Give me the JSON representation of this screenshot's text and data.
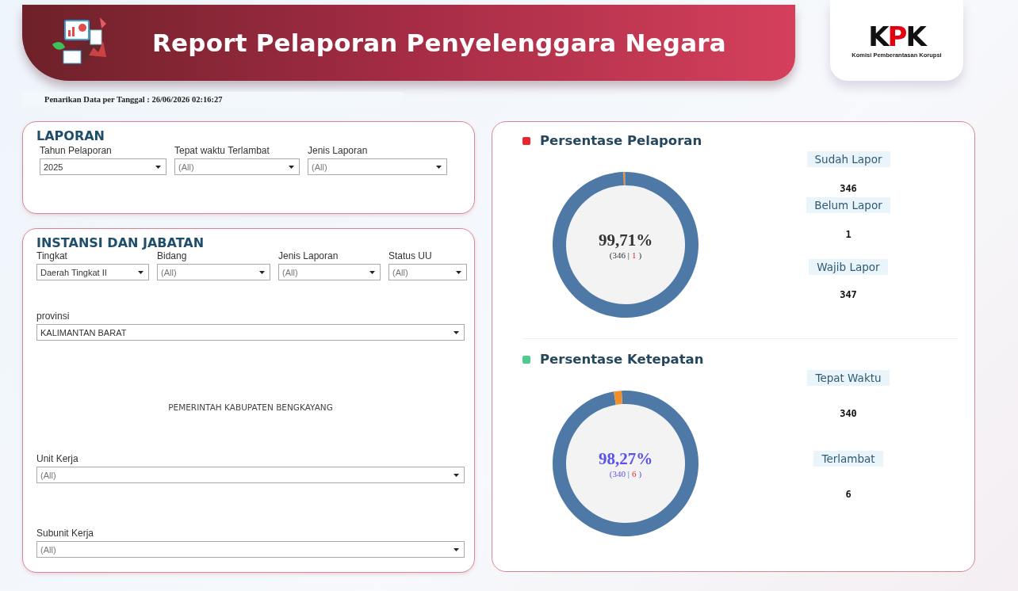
{
  "header": {
    "title": "Report Pelaporan Penyelenggara Negara",
    "logo": {
      "mark_parts": [
        "K",
        "P",
        "K"
      ],
      "caption": "Komisi Pemberantasan Korupsi"
    }
  },
  "timestamp": "Penarikan Data per Tanggal : 26/06/2026 02:16:27",
  "filter_panels": [
    {
      "title": "LAPORAN",
      "rows": [
        [
          {
            "label": "Tahun Pelaporan",
            "value": "2025",
            "default": false
          },
          {
            "label": "Tepat waktu Terlambat",
            "value": "(All)",
            "default": true
          },
          {
            "label": "Jenis Laporan",
            "value": "(All)",
            "default": true
          }
        ]
      ]
    },
    {
      "title": "INSTANSI DAN JABATAN",
      "rows": [
        [
          {
            "label": "Tingkat",
            "value": "Daerah Tingkat II",
            "default": false
          },
          {
            "label": "Bidang",
            "value": "(All)",
            "default": true
          },
          {
            "label": "Jenis Laporan",
            "value": "(All)",
            "default": true
          },
          {
            "label": "Status UU",
            "value": "(All)",
            "default": true
          }
        ],
        [
          {
            "label": "provinsi",
            "value": "KALIMANTAN BARAT",
            "default": false
          }
        ],
        [
          {
            "label": "Unit Kerja",
            "value": "(All)",
            "default": true
          }
        ],
        [
          {
            "label": "Subunit Kerja",
            "value": "(All)",
            "default": true
          }
        ]
      ],
      "note": "PEMERINTAH KABUPATEN BENGKAYANG"
    }
  ],
  "charts": [
    {
      "title": "Persentase Pelaporan",
      "legend": {
        "color": "#e8262b"
      },
      "percent": {
        "text": "99,71%",
        "color": "#333333"
      },
      "summary": [
        {
          "text": "(346 |",
          "alert": false
        },
        {
          "text": "1",
          "alert": true
        },
        {
          "text": ")",
          "alert": false
        }
      ],
      "chart_data": {
        "type": "donut",
        "values": [
          99.71,
          0.29
        ]
      },
      "stats": [
        {
          "label": "Sudah Lapor",
          "value": "346"
        },
        {
          "label": "Belum Lapor",
          "value": "1"
        },
        {
          "label": "Wajib Lapor",
          "value": "347"
        }
      ]
    },
    {
      "title": "Persentase Ketepatan",
      "legend": {
        "color": "#4ecb8d"
      },
      "percent": {
        "text": "98,27%",
        "color": "#5b50f0"
      },
      "summary": [
        {
          "text": "(340 |",
          "alert": false
        },
        {
          "text": "6",
          "alert": true
        },
        {
          "text": ")",
          "alert": false
        }
      ],
      "chart_data": {
        "type": "donut",
        "values": [
          98.27,
          1.73
        ]
      },
      "stats": [
        {
          "label": "Tepat Waktu",
          "value": "340"
        },
        {
          "label": "Terlambat",
          "value": "6"
        }
      ]
    }
  ]
}
